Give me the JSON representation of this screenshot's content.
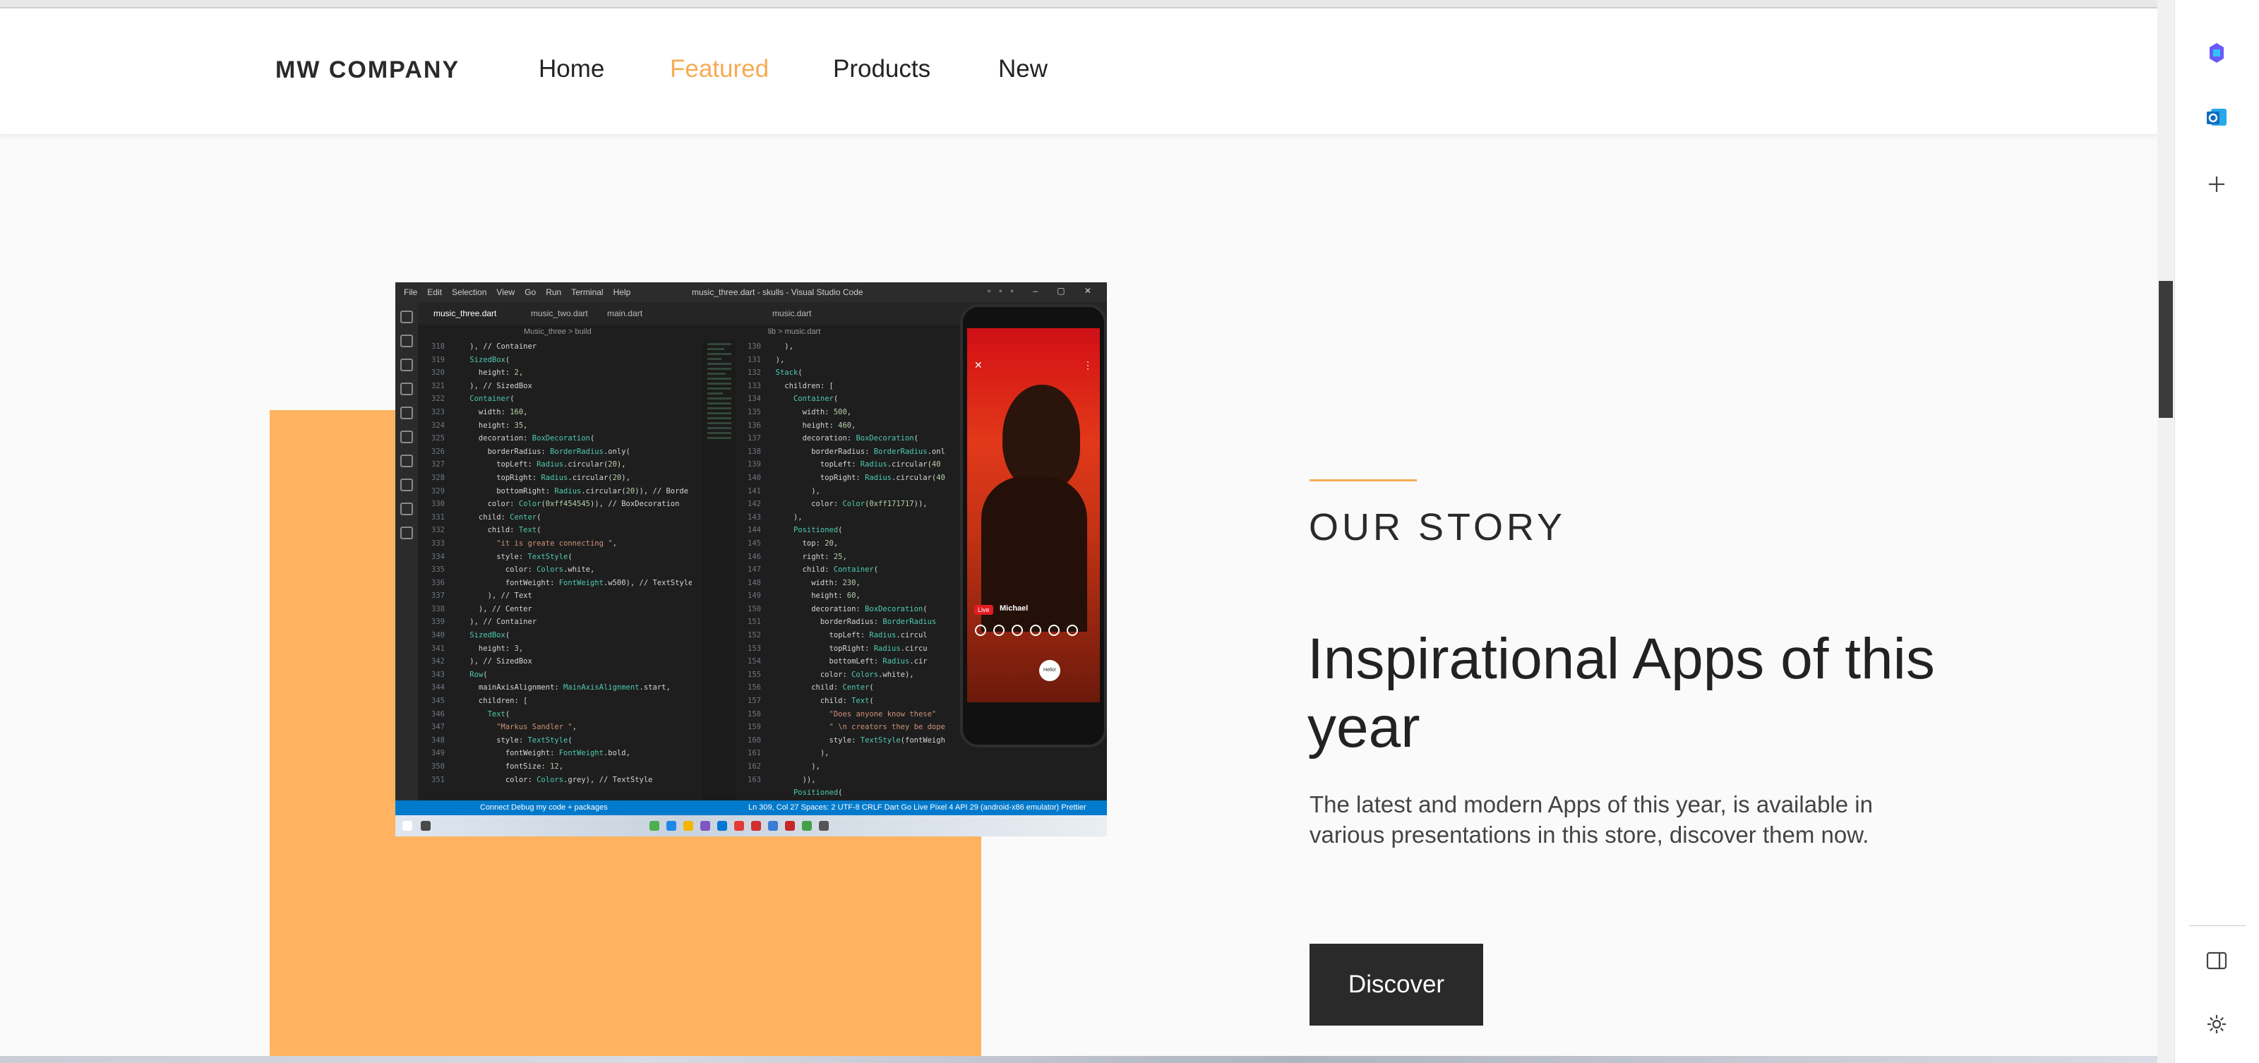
{
  "nav": {
    "brand": "MW COMPANY",
    "links": [
      "Home",
      "Featured",
      "Products",
      "New"
    ],
    "active": "Featured"
  },
  "colors": {
    "accent": "#f7ab54",
    "block": "#ffb360",
    "button": "#2a2a2a"
  },
  "screenshot": {
    "menu": [
      "File",
      "Edit",
      "Selection",
      "View",
      "Go",
      "Run",
      "Terminal",
      "Help"
    ],
    "window_title": "music_three.dart - skulls - Visual Studio Code",
    "tabs": [
      "music_three.dart",
      "music_two.dart",
      "main.dart",
      "music.dart"
    ],
    "breadcrumb_left": "Music_three > build",
    "breadcrumb_right": "lib > music.dart",
    "status_left": "Connect   Debug my code + packages",
    "status_right": "Ln 309, Col 27   Spaces: 2   UTF-8   CRLF   Dart   Go Live   Pixel 4 API 29 (android-x86 emulator)   Prettier",
    "phone": {
      "badge": "Live",
      "name": "Michael",
      "hello": "Hello!"
    }
  },
  "story": {
    "eyebrow": "OUR STORY",
    "title": "Inspirational Apps of this year",
    "text": "The latest and modern Apps of this year, is available in various presentations in this store, discover them now.",
    "button": "Discover"
  },
  "sidepanel": {
    "icons": [
      "copilot-icon",
      "outlook-icon",
      "add-icon",
      "sidebar-toggle-icon",
      "settings-icon"
    ]
  }
}
